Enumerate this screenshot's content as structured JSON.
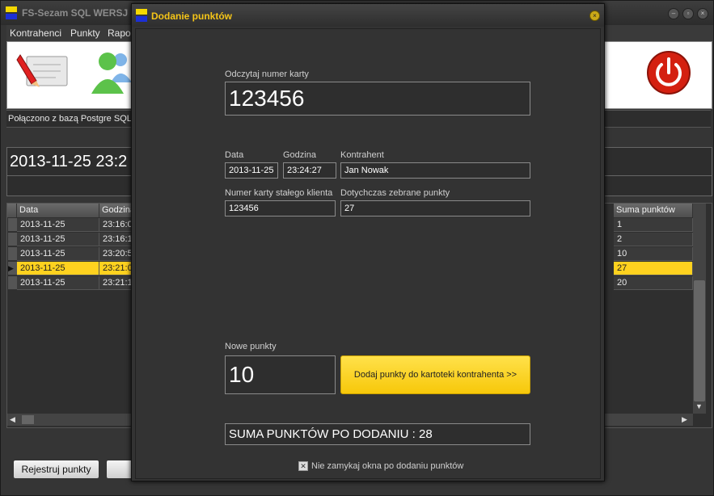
{
  "main_window": {
    "title": "FS-Sezam SQL    WERSJ",
    "menu": [
      "Kontrahenci",
      "Punkty",
      "Rapo"
    ],
    "status": "Połączono z bazą Postgre SQL",
    "date_display": "2013-11-25 23:2",
    "table": {
      "columns": [
        "Data",
        "Godzina",
        "Suma punktów"
      ],
      "rows": [
        {
          "date": "2013-11-25",
          "time": "23:16:0",
          "sum": "1"
        },
        {
          "date": "2013-11-25",
          "time": "23:16:1",
          "sum": "2"
        },
        {
          "date": "2013-11-25",
          "time": "23:20:5",
          "sum": "10"
        },
        {
          "date": "2013-11-25",
          "time": "23:21:0",
          "sum": "27",
          "selected": true
        },
        {
          "date": "2013-11-25",
          "time": "23:21:1",
          "sum": "20"
        }
      ]
    },
    "register_button": "Rejestruj punkty",
    "colors": {
      "selected_row": "#ffd21f",
      "logo_yellow": "#f5d800",
      "logo_blue": "#1c2fd6"
    }
  },
  "dialog": {
    "title": "Dodanie punktów",
    "card_label": "Odczytaj numer karty",
    "card_value": "123456",
    "date_label": "Data",
    "date_value": "2013-11-25",
    "time_label": "Godzina",
    "time_value": "23:24:27",
    "contractor_label": "Kontrahent",
    "contractor_value": "Jan Nowak",
    "loyalty_label": "Numer karty stałego klienta",
    "loyalty_value": "123456",
    "collected_label": "Dotychczas zebrane punkty",
    "collected_value": "27",
    "new_points_label": "Nowe punkty",
    "new_points_value": "10",
    "add_button": "Dodaj punkty do kartoteki kontrahenta >>",
    "sum_text": "SUMA PUNKTÓW PO DODANIU : 28",
    "keep_open_label": "Nie zamykaj okna po dodaniu punktów",
    "keep_open_checked": true,
    "accent_color": "#f5c518"
  }
}
